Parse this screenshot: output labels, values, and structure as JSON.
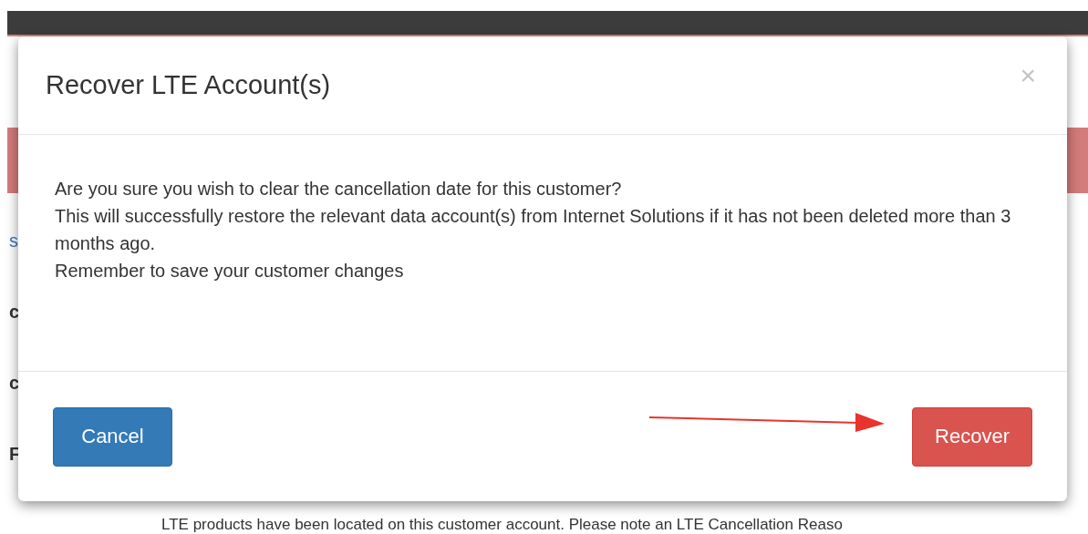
{
  "page_behind": {
    "fragments": [
      {
        "text": "s",
        "kind": "link"
      },
      {
        "text": "c",
        "kind": "label"
      },
      {
        "text": "c",
        "kind": "label"
      },
      {
        "text": "F",
        "kind": "label"
      }
    ],
    "notice": "LTE products have been located on this customer account. Please note an LTE Cancellation Reaso"
  },
  "modal": {
    "title": "Recover LTE Account(s)",
    "close": "×",
    "body": [
      "Are you sure you wish to clear the cancellation date for this customer?",
      "This will successfully restore the relevant data account(s) from Internet Solutions if it has not been deleted more than 3 months ago.",
      "Remember to save your customer changes"
    ],
    "buttons": [
      {
        "label": "Cancel",
        "kind": "primary"
      },
      {
        "label": "Recover",
        "kind": "danger"
      }
    ]
  }
}
